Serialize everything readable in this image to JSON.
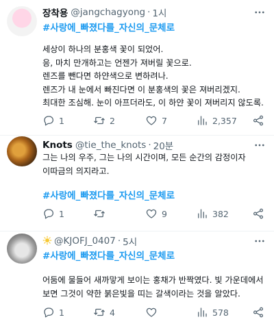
{
  "tweets": [
    {
      "display_name": "장착용",
      "handle": "@jangchagyong",
      "time": "1시",
      "hashtag": "#사랑에_빠졌다를_자신의_문체로",
      "lines": [
        "세상이 하나의 분홍색 꽃이 되었어.",
        "응, 마치 만개하고는 언젠가 져버릴 꽃으로.",
        "렌즈를 뺀다면 하얀색으로 변하려나.",
        "렌즈가 내 눈에서 빠진다면 이 분홍색의 꽃은 져버리겠지.",
        "최대한 조심해. 눈이 아프더라도, 이 하얀 꽃이 져버리지 않도록."
      ],
      "replies": "1",
      "retweets": "2",
      "likes": "7",
      "views": "2,357"
    },
    {
      "display_name": "Knots",
      "handle": "@tie_the_knots",
      "time": "20분",
      "hashtag": "#사랑에_빠졌다를_자신의_문체로",
      "lines": [
        "그는 나의 우주, 그는 나의 시간이며, 모든 순간의 감정이자",
        "이따금의 의지라고."
      ],
      "replies": "1",
      "retweets": "",
      "likes": "9",
      "views": "382"
    },
    {
      "display_name": "",
      "handle": "@KJOFJ_0407",
      "time": "5시",
      "hashtag": "#사랑에_빠졌다를_자신의_문체로",
      "lines": [
        "어둠에 물들어 새까맣게 보이는 홍채가 반짝였다. 빛 가운데에서",
        "보면 그것이 약한 붉은빛을 띠는 갈색이라는 것을 알았다."
      ],
      "replies": "1",
      "retweets": "4",
      "likes": "",
      "views": "578"
    }
  ],
  "icons": {
    "more": "more-horizontal-icon",
    "reply": "reply-icon",
    "retweet": "retweet-icon",
    "like": "heart-icon",
    "views": "views-chart-icon",
    "share": "share-icon",
    "sun": "sun-emoji-icon"
  },
  "colors": {
    "hashtag": "#1d9bf0",
    "muted": "#536471",
    "text": "#0f1419",
    "divider": "#eff3f4"
  }
}
